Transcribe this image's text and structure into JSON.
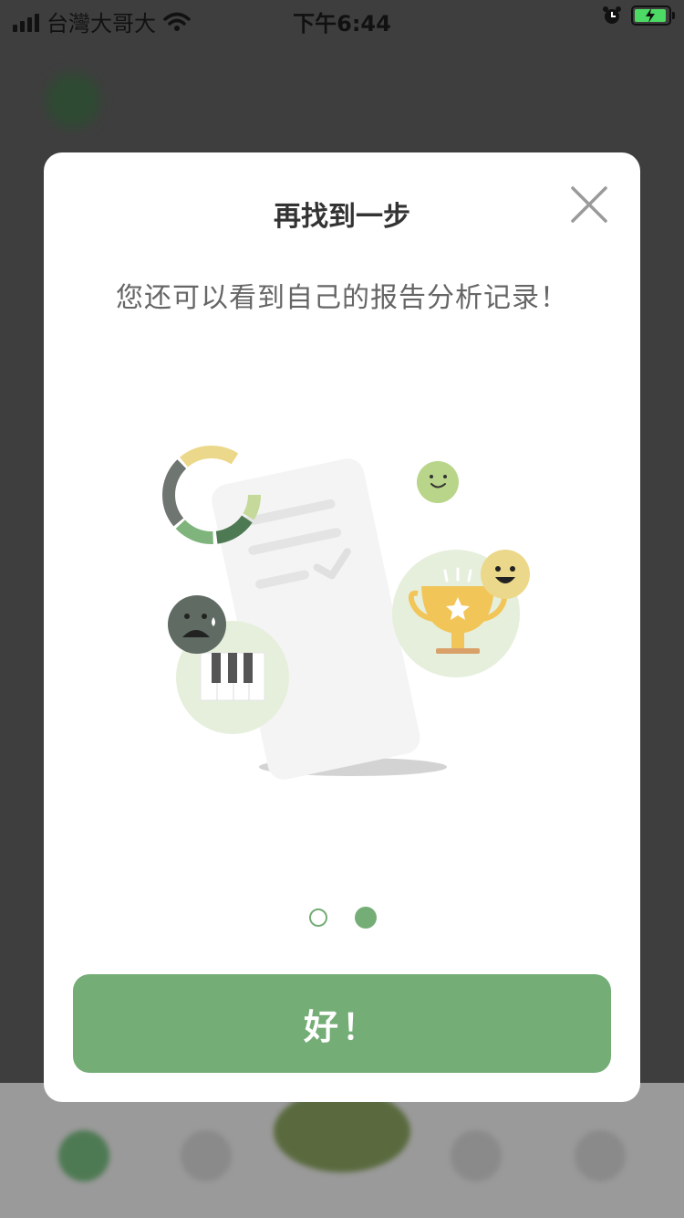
{
  "status_bar": {
    "carrier": "台灣大哥大",
    "time": "下午6:44"
  },
  "dialog": {
    "title": "再找到一步",
    "subtitle": "您还可以看到自己的报告分析记录！",
    "ok_label": "好！",
    "pagination": {
      "current": 2,
      "total": 2
    }
  },
  "colors": {
    "accent": "#74ad76",
    "light_green": "#e6efdc",
    "yellow": "#ecd88a",
    "gold": "#f2c558",
    "dark_gray": "#5f6b63"
  },
  "icons": {
    "close": "close-icon",
    "wifi": "wifi-icon",
    "alarm": "alarm-icon",
    "battery": "battery-charging-icon"
  }
}
